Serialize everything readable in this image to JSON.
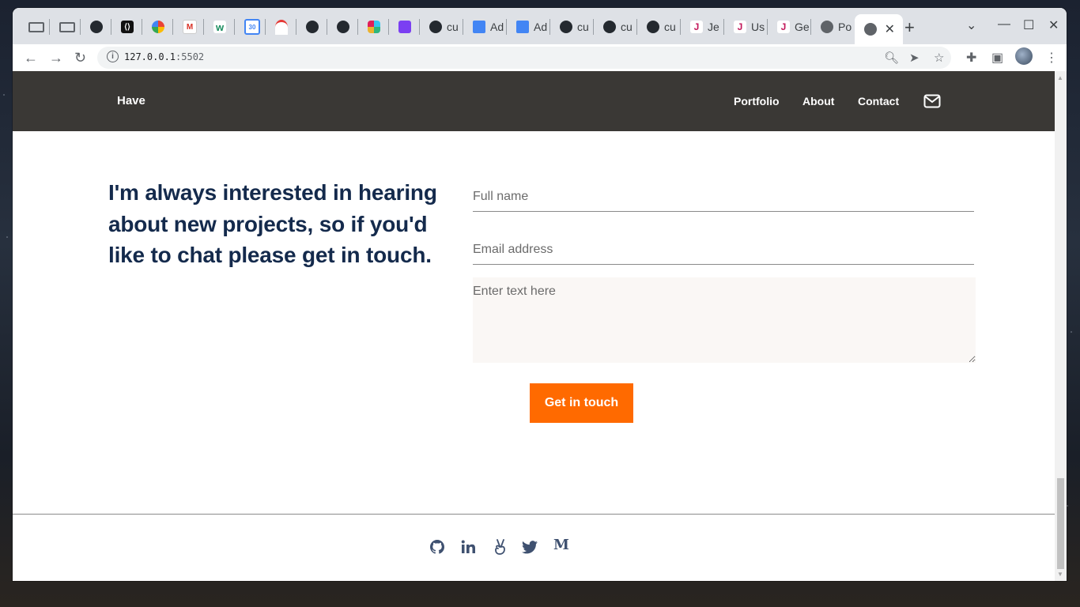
{
  "browser": {
    "tabs": [
      {
        "title": "",
        "favicon": "drive-icon"
      },
      {
        "title": "",
        "favicon": "drive-icon"
      },
      {
        "title": "",
        "favicon": "github-icon"
      },
      {
        "title": "",
        "favicon": "code-icon"
      },
      {
        "title": "",
        "favicon": "ring-icon"
      },
      {
        "title": "",
        "favicon": "gmail-icon"
      },
      {
        "title": "",
        "favicon": "w-icon"
      },
      {
        "title": "",
        "favicon": "calendar-icon"
      },
      {
        "title": "",
        "favicon": "gauge-icon"
      },
      {
        "title": "",
        "favicon": "github-icon"
      },
      {
        "title": "",
        "favicon": "github-icon"
      },
      {
        "title": "",
        "favicon": "slack-icon"
      },
      {
        "title": "",
        "favicon": "app-icon"
      },
      {
        "title": "cu",
        "favicon": "github-icon"
      },
      {
        "title": "Ad",
        "favicon": "docs-icon"
      },
      {
        "title": "Ad",
        "favicon": "docs-icon"
      },
      {
        "title": "cu",
        "favicon": "github-icon"
      },
      {
        "title": "cu",
        "favicon": "github-icon"
      },
      {
        "title": "cu",
        "favicon": "github-icon"
      },
      {
        "title": "Je",
        "favicon": "jest-icon"
      },
      {
        "title": "Us",
        "favicon": "jest-icon"
      },
      {
        "title": "Ge",
        "favicon": "jest-icon"
      },
      {
        "title": "Po",
        "favicon": "globe-icon"
      },
      {
        "title": "",
        "favicon": "globe-icon",
        "active": true
      }
    ],
    "url_host": "127.0.0.1",
    "url_port": ":5502",
    "new_tab_label": "+",
    "close_label": "✕"
  },
  "site": {
    "brand": "Have",
    "nav": {
      "portfolio": "Portfolio",
      "about": "About",
      "contact": "Contact"
    },
    "headline": "I'm always interested in hearing about new projects, so if you'd like to chat please get in touch.",
    "form": {
      "name_placeholder": "Full name",
      "email_placeholder": "Email address",
      "message_placeholder": "Enter text here",
      "submit_label": "Get in touch"
    },
    "social": [
      "github-icon",
      "linkedin-icon",
      "angellist-icon",
      "twitter-icon",
      "medium-icon"
    ],
    "medium_glyph": "M"
  },
  "colors": {
    "nav_bg": "#3a3835",
    "headline": "#142a4c",
    "accent": "#ff6a00",
    "social": "#3f5170"
  }
}
